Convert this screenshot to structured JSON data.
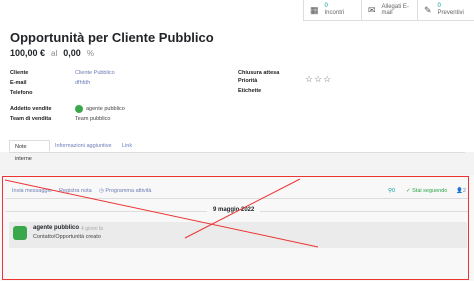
{
  "stats": {
    "incontri": {
      "count": "0",
      "label": "Incontri",
      "icon": "calendar-icon"
    },
    "allegati": {
      "label": "Allegati E-mail",
      "icon": "email-icon"
    },
    "preventivi": {
      "count": "0",
      "label": "Preventivi",
      "icon": "edit-icon"
    }
  },
  "title": "Opportunità per Cliente Pubblico",
  "amounts": {
    "revenue": "100,00 €",
    "at": "al",
    "probability": "0,00",
    "percent": "%"
  },
  "fields": {
    "cliente": {
      "label": "Cliente",
      "value": "Cliente Pubblico"
    },
    "email": {
      "label": "E-mail",
      "value": "dfhfdh"
    },
    "telefono": {
      "label": "Telefono",
      "value": ""
    },
    "addetto": {
      "label": "Addetto vendite",
      "value": "agente pubblico"
    },
    "team": {
      "label": "Team di vendita",
      "value": "Team pubblico"
    },
    "chiusura": {
      "label": "Chiusura attesa",
      "value": ""
    },
    "priorita": {
      "label": "Priorità",
      "value": "☆☆☆"
    },
    "etichette": {
      "label": "Etichette",
      "value": ""
    }
  },
  "tabs": [
    "Note interne",
    "Informazioni aggiuntive",
    "Link"
  ],
  "chatter": {
    "send_message": "Invia messaggio",
    "log_note": "Registra nota",
    "schedule_activity": "Programma attività",
    "attachments_count": "0",
    "following": "Stai seguendo",
    "followers_count": "2",
    "date": "9 maggio 2022",
    "message": {
      "author": "agente pubblico",
      "time": "- 4 giorni fa",
      "body": "Contatto/Opportunità creato"
    }
  },
  "colors": {
    "accent": "#00a09d",
    "link": "#6b7cb6",
    "avatar": "#3aa84a",
    "annotation": "#e33333"
  }
}
